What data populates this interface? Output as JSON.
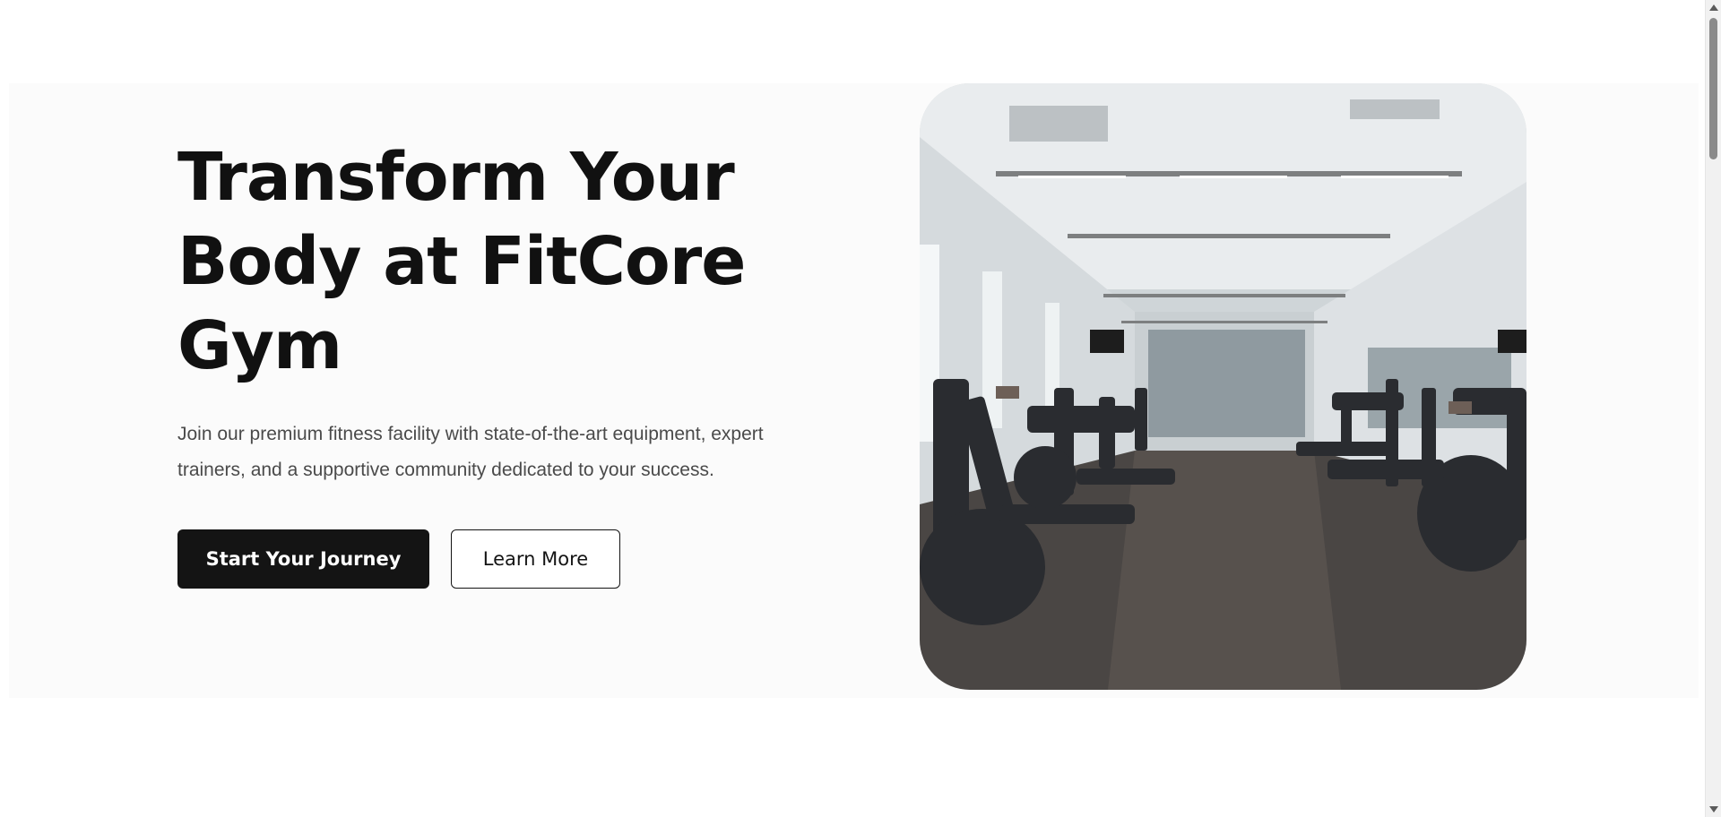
{
  "hero": {
    "title_line1": "Transform Your",
    "title_line2": "Body at FitCore",
    "title_line3": "Gym",
    "description": "Join our premium fitness facility with state-of-the-art equipment, expert trainers, and a supportive community dedicated to your success.",
    "primary_cta": "Start Your Journey",
    "secondary_cta": "Learn More",
    "image_label": "gym-interior-photo"
  },
  "colors": {
    "primary": "#141414",
    "background": "#fbfbfb",
    "text_muted": "#4a4a4a"
  }
}
